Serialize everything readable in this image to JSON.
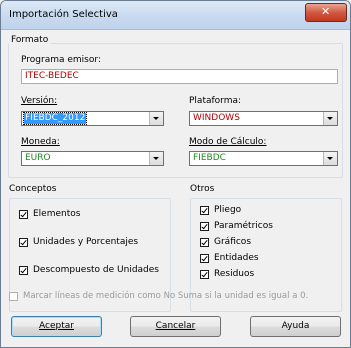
{
  "window": {
    "title": "Importación Selectiva",
    "close_label": "✕"
  },
  "formato": {
    "group_label": "Formato",
    "programa_emisor_label": "Programa emisor:",
    "programa_emisor_value": "ITEC-BEDEC",
    "version_label": "Versión:",
    "version_value": "FIEBDC_2012",
    "plataforma_label": "Plataforma:",
    "plataforma_value": "WINDOWS",
    "moneda_label": "Moneda:",
    "moneda_value": "EURO",
    "modo_calculo_label": "Modo de Cálculo:",
    "modo_calculo_value": "FIEBDC"
  },
  "conceptos": {
    "group_label": "Conceptos",
    "items": [
      {
        "label": "Elementos",
        "checked": true
      },
      {
        "label": "Unidades y Porcentajes",
        "checked": true
      },
      {
        "label": "Descompuesto de Unidades",
        "checked": true
      }
    ]
  },
  "otros": {
    "group_label": "Otros",
    "items": [
      {
        "label": "Pliego",
        "checked": true
      },
      {
        "label": "Paramétricos",
        "checked": true
      },
      {
        "label": "Gráficos",
        "checked": true
      },
      {
        "label": "Entidades",
        "checked": true
      },
      {
        "label": "Residuos",
        "checked": true
      }
    ]
  },
  "marcar_lineas": {
    "label": "Marcar líneas de medición como No Suma si la unidad es igual a 0.",
    "checked": false
  },
  "buttons": {
    "aceptar": "Aceptar",
    "cancelar": "Cancelar",
    "ayuda": "Ayuda"
  },
  "colors": {
    "value_green": "#1f8a1f",
    "value_red": "#b00000",
    "selection": "#3399ff"
  }
}
